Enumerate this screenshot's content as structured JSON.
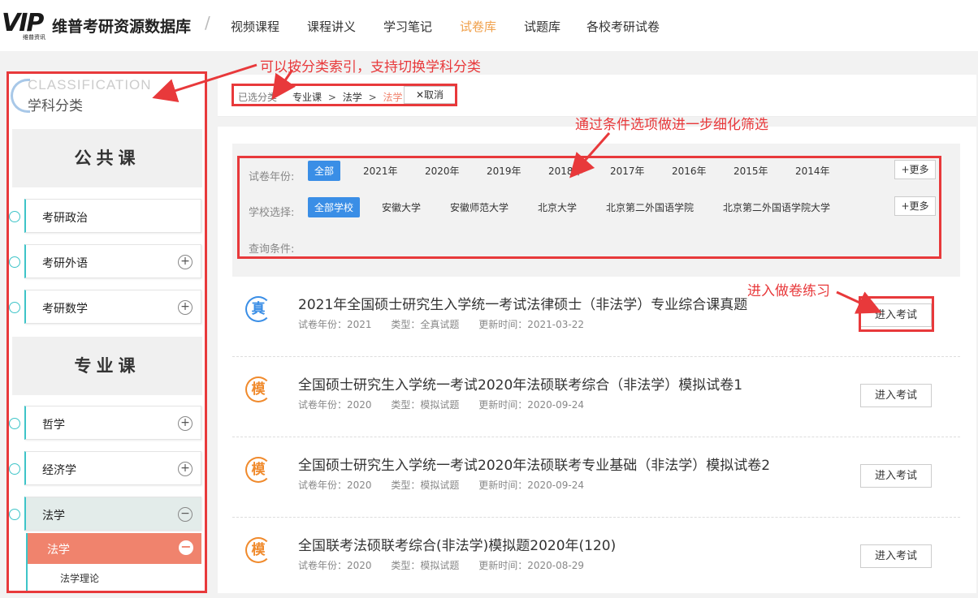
{
  "header": {
    "logo_text": "VIP",
    "logo_sub": "维普资讯",
    "brand": "维普考研资源数据库",
    "nav": [
      {
        "label": "视频课程",
        "active": false
      },
      {
        "label": "课程讲义",
        "active": false
      },
      {
        "label": "学习笔记",
        "active": false
      },
      {
        "label": "试卷库",
        "active": true
      },
      {
        "label": "试题库",
        "active": false
      },
      {
        "label": "各校考研试卷",
        "active": false
      }
    ]
  },
  "sidebar": {
    "heading_en": "CLASSIFICATION",
    "heading_cn": "学科分类",
    "public_title": "公共课",
    "public_items": [
      {
        "label": "考研政治",
        "expandable": false
      },
      {
        "label": "考研外语",
        "expandable": true
      },
      {
        "label": "考研数学",
        "expandable": true
      }
    ],
    "major_title": "专业课",
    "major_items": [
      {
        "label": "哲学",
        "toggle": "+"
      },
      {
        "label": "经济学",
        "toggle": "+"
      },
      {
        "label": "法学",
        "toggle": "−"
      }
    ],
    "sub_active": {
      "label": "法学",
      "toggle": "−"
    },
    "sub_leaf": {
      "label": "法学理论"
    }
  },
  "breadcrumb": {
    "label": "已选分类",
    "parts": [
      "专业课",
      "法学",
      "法学"
    ],
    "separator": ">",
    "cancel_label": "取消"
  },
  "filters": {
    "year_label": "试卷年份:",
    "years": [
      "全部",
      "2021年",
      "2020年",
      "2019年",
      "2018年",
      "2017年",
      "2016年",
      "2015年",
      "2014年"
    ],
    "school_label": "学校选择:",
    "schools": [
      "全部学校",
      "安徽大学",
      "安徽师范大学",
      "北京大学",
      "北京第二外国语学院",
      "北京第二外国语学院大学"
    ],
    "query_label": "查询条件:",
    "more_label": "+更多"
  },
  "exams": [
    {
      "badge": "真",
      "badge_color": "#3a8ee6",
      "title": "2021年全国硕士研究生入学统一考试法律硕士（非法学）专业综合课真题",
      "year": "试卷年份：2021",
      "type": "类型：全真试题",
      "updated": "更新时间：2021-03-22",
      "button": "进入考试"
    },
    {
      "badge": "模",
      "badge_color": "#f08a2c",
      "title": "全国硕士研究生入学统一考试2020年法硕联考综合（非法学）模拟试卷1",
      "year": "试卷年份：2020",
      "type": "类型：模拟试题",
      "updated": "更新时间：2020-09-24",
      "button": "进入考试"
    },
    {
      "badge": "模",
      "badge_color": "#f08a2c",
      "title": "全国硕士研究生入学统一考试2020年法硕联考专业基础（非法学）模拟试卷2",
      "year": "试卷年份：2020",
      "type": "类型：模拟试题",
      "updated": "更新时间：2020-09-24",
      "button": "进入考试"
    },
    {
      "badge": "模",
      "badge_color": "#f08a2c",
      "title": "全国联考法硕联考综合(非法学)模拟题2020年(120)",
      "year": "试卷年份：2020",
      "type": "类型：模拟试题",
      "updated": "更新时间：2020-08-29",
      "button": "进入考试"
    }
  ],
  "annotations": {
    "classify": "可以按分类索引，支持切换学科分类",
    "filter": "通过条件选项做进一步细化筛选",
    "practice": "进入做卷练习"
  },
  "colors": {
    "accent": "#f0a04b",
    "annotation": "#e8393b",
    "teal": "#3ec4c8",
    "selected": "#3a8ee6",
    "active_sub": "#f0836d"
  }
}
